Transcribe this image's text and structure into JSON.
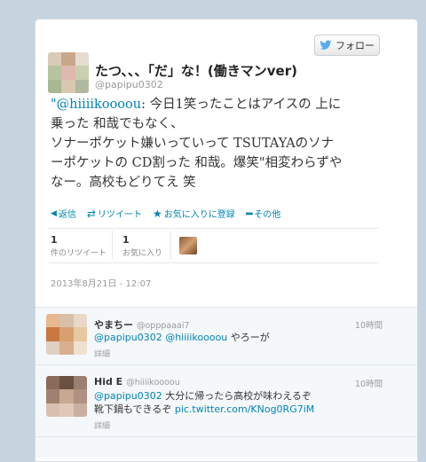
{
  "header": {
    "follow_label": "フォロー"
  },
  "tweet": {
    "name": "たつ、、、「だ」な！(働きマンver)",
    "handle": "@papipu0302",
    "lines": [
      {
        "mention": "\"@hiiiikoooou",
        "text": ": 今日1笑ったことはアイスの 上に"
      },
      {
        "mention": "",
        "text": "乗った 和哉でもなく、"
      },
      {
        "mention": "",
        "text": "ソナーポケット嫌いっていって TSUTAYAのソナ"
      },
      {
        "mention": "",
        "text": "ーポケットの CD割った 和哉。爆笑\"相変わらずや"
      },
      {
        "mention": "",
        "text": "なー。高校もどりてえ 笑"
      }
    ],
    "actions": [
      {
        "icon": "reply-icon",
        "glyph": "◀",
        "label": "返信"
      },
      {
        "icon": "retweet-icon",
        "glyph": "⇄",
        "label": "リツイート"
      },
      {
        "icon": "favorite-star-icon",
        "glyph": "★",
        "label": "お気に入りに登録"
      },
      {
        "icon": "more-dots-icon",
        "glyph": "●●●",
        "label": "その他"
      }
    ],
    "retweets": {
      "count": "1",
      "label": "件のリツイート"
    },
    "favorites": {
      "count": "1",
      "label": "お気に入り"
    },
    "date": "2013年8月21日 - 12:07"
  },
  "replies": [
    {
      "name": "やまちー",
      "handle": "@opppaaai7",
      "time": "10時間",
      "lines": [
        {
          "mentions": "@papipu0302 @hiiiikoooou",
          "text": " やろーが"
        }
      ],
      "detail": "詳細"
    },
    {
      "name": "Hid E",
      "handle": "@hiiiikoooou",
      "time": "10時間",
      "lines": [
        {
          "mentions": "@papipu0302",
          "text": " 大分に帰ったら高校が味わえるぞ"
        },
        {
          "mentions": "",
          "text": "靴下鍋もできるぞ ",
          "link": "pic.twitter.com/KNog0RG7iM"
        }
      ],
      "detail": "詳細"
    }
  ],
  "colors": {
    "link": "#0084b4",
    "background": "#c6d4df"
  }
}
